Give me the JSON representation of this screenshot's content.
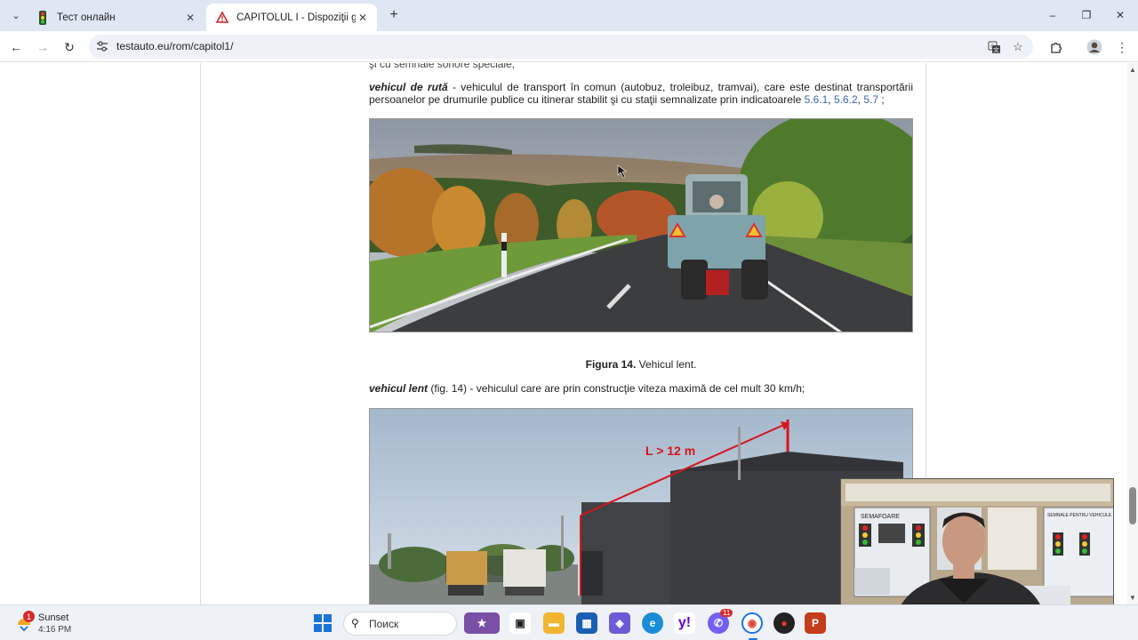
{
  "browser": {
    "tabs": [
      {
        "title": "Тест онлайн",
        "icon": "traffic-light-icon",
        "active": false
      },
      {
        "title": "CAPITOLUL I - Dispoziţii genera",
        "icon": "warning-triangle-icon",
        "active": true
      }
    ],
    "url": "testauto.eu/rom/capitol1/"
  },
  "page": {
    "cut_line": "şi cu semnale sonore speciale;",
    "def_route": {
      "term": "vehicul de rută",
      "text": " - vehiculul de transport în comun (autobuz, troleibuz, tramvai), care este destinat transportării persoanelor pe drumurile publice cu itinerar stabilit şi cu staţii semnalizate prin indicatoarele ",
      "links": [
        "5.6.1",
        "5.6.2",
        "5.7"
      ],
      "sep1": ", ",
      "sep2": ",  ",
      "end": " ;"
    },
    "figure14_caption": {
      "label": "Figura 14.",
      "text": " Vehicul lent."
    },
    "def_slow": {
      "term": "vehicul lent",
      "text": " (fig. 14) - vehiculul care are prin construcţie viteza maximă de cel mult 30 km/h;"
    },
    "figure15_label": "L > 12 m"
  },
  "webcam": {
    "board_label": "SEMAFOARE",
    "right_label": "SEMNALE PENTRU VEHICULE"
  },
  "taskbar": {
    "weather_title": "Sunset",
    "weather_time": "4:16 PM",
    "weather_badge": "1",
    "search_label": "Поиск",
    "viber_badge": "11"
  },
  "colors": {
    "accent": "#3a66b5",
    "tabstrip": "#dfe7f5",
    "taskbar": "#eef1f6"
  }
}
